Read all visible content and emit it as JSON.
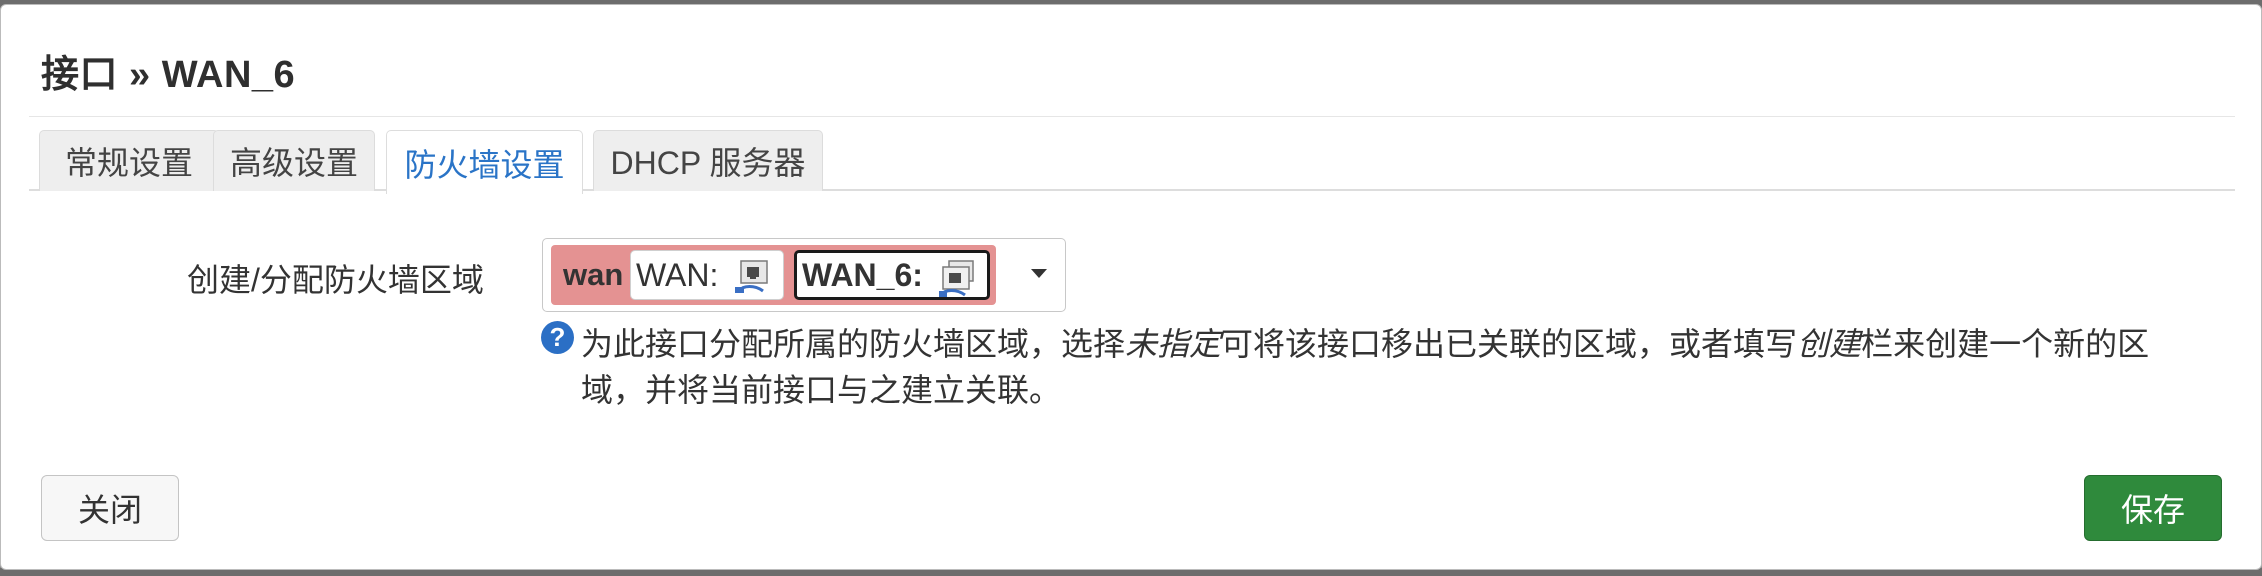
{
  "dialog": {
    "title": "接口 » WAN_6"
  },
  "tabs": [
    {
      "label": "常规设置",
      "active": false
    },
    {
      "label": "高级设置",
      "active": false
    },
    {
      "label": "防火墙设置",
      "active": true
    },
    {
      "label": "DHCP 服务器",
      "active": false
    }
  ],
  "firewall": {
    "field_label": "创建/分配防火墙区域",
    "selected_zone": {
      "name": "wan",
      "color": "#e49292",
      "interfaces": [
        {
          "label": "WAN:",
          "icon": "ethernet-port-icon",
          "selected": false
        },
        {
          "label": "WAN_6:",
          "icon": "ethernet-port-icon",
          "selected": true
        }
      ]
    },
    "help": {
      "part1": "为此接口分配所属的防火墙区域，选择",
      "unspecified": "未指定",
      "part2": "可将该接口移出已关联的区域，或者填写",
      "create": "创建",
      "part3": "栏来创建一个新的区域，并将当前接口与之建立关联。"
    }
  },
  "footer": {
    "close_label": "关闭",
    "save_label": "保存"
  },
  "colors": {
    "accent_tab": "#2a74c7",
    "save_button": "#2f8a3c",
    "help_icon": "#2b6fc5"
  }
}
